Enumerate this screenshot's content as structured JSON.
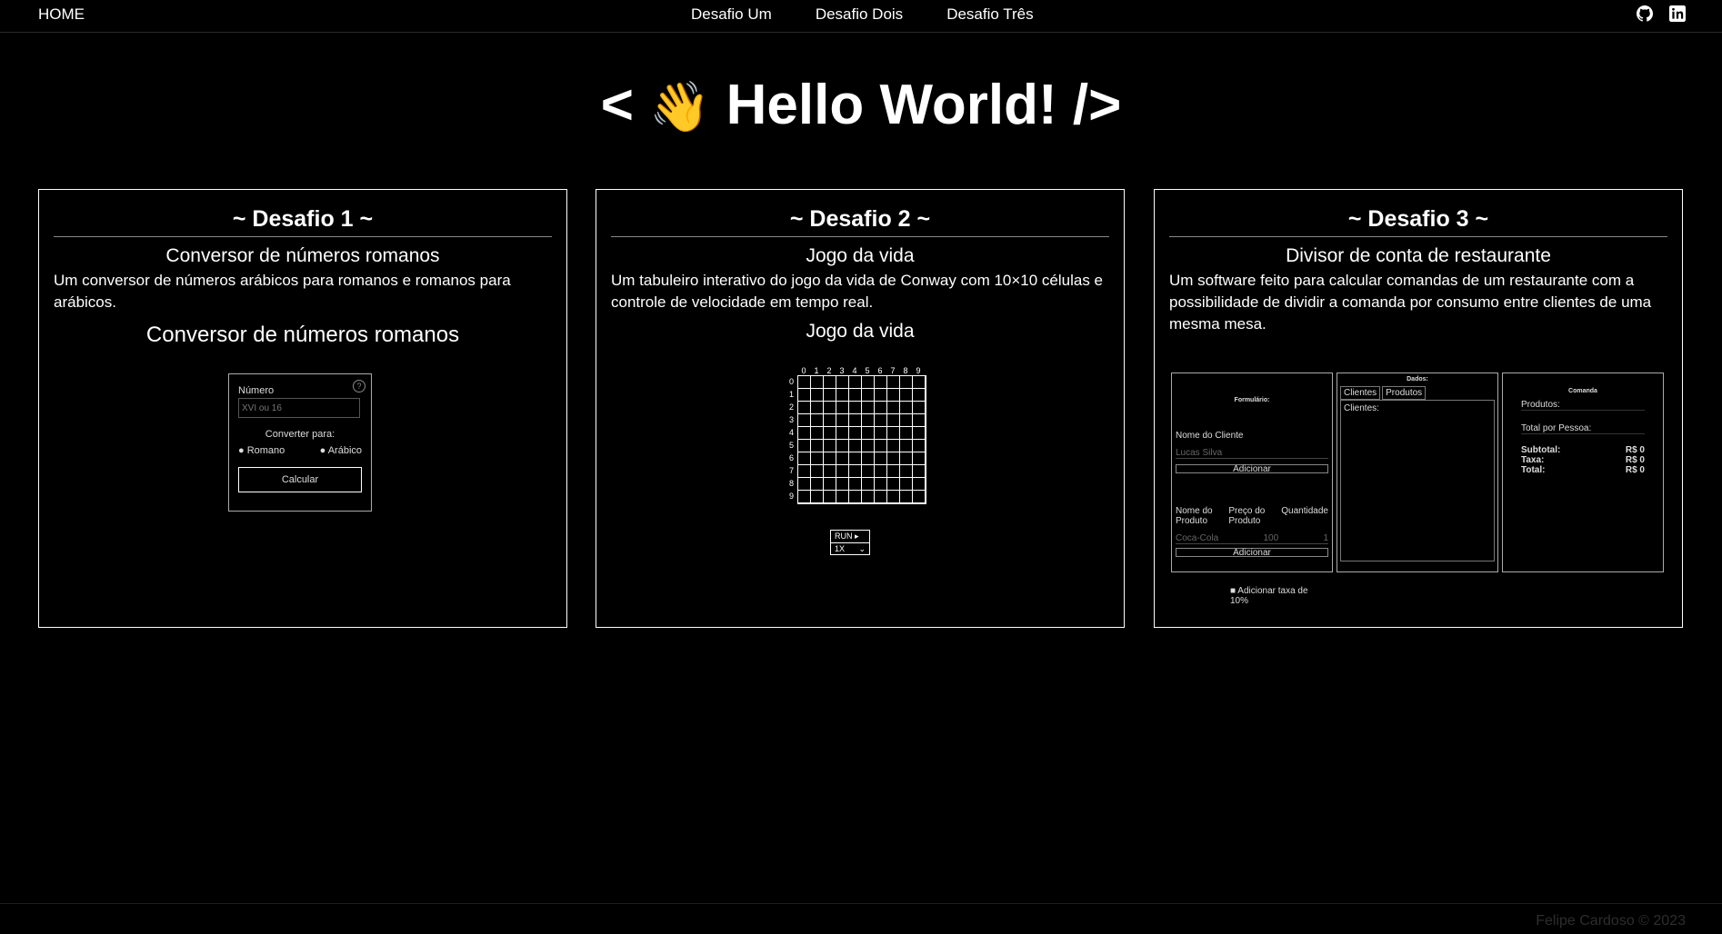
{
  "nav": {
    "home": "HOME",
    "links": [
      "Desafio Um",
      "Desafio Dois",
      "Desafio Três"
    ],
    "icons": [
      "github-icon",
      "linkedin-icon"
    ]
  },
  "hero": {
    "left": "<",
    "emoji": "👋",
    "text": "Hello World!",
    "right": "/>"
  },
  "cards": [
    {
      "title": "~ Desafio 1 ~",
      "subtitle": "Conversor de números romanos",
      "description": "Um conversor de números arábicos para romanos e romanos para arábicos.",
      "preview_title": "Conversor de números romanos",
      "preview": {
        "label_number": "Número",
        "input_placeholder": "XVI ou 16",
        "convert_label": "Converter para:",
        "options": [
          "Romano",
          "Arábico"
        ],
        "button": "Calcular",
        "help": "?"
      }
    },
    {
      "title": "~ Desafio 2 ~",
      "subtitle": "Jogo da vida",
      "description": "Um tabuleiro interativo do jogo da vida de Conway com 10×10 células e controle de velocidade em tempo real.",
      "preview_title": "Jogo da vida",
      "preview": {
        "col_labels": [
          "0",
          "1",
          "2",
          "3",
          "4",
          "5",
          "6",
          "7",
          "8",
          "9"
        ],
        "row_labels": [
          "0",
          "1",
          "2",
          "3",
          "4",
          "5",
          "6",
          "7",
          "8",
          "9"
        ],
        "run_button": "RUN ▸",
        "speed": "1X"
      }
    },
    {
      "title": "~ Desafio 3 ~",
      "subtitle": "Divisor de conta de restaurante",
      "description": "Um software feito para calcular comandas de um restaurante com a possibilidade de dividir a comanda por consumo entre clientes de uma mesma mesa.",
      "preview": {
        "form_title": "Formulário:",
        "client_label": "Nome do Cliente",
        "client_placeholder": "Lucas Silva",
        "add_button": "Adicionar",
        "product_label": "Nome do Produto",
        "price_label": "Preço do Produto",
        "qty_label": "Quantidade",
        "product_placeholder": "Coca-Cola",
        "price_placeholder": "100",
        "qty_placeholder": "1",
        "tax_label": "Adicionar taxa de 10%",
        "data_title": "Dados:",
        "tabs": [
          "Clientes",
          "Produtos"
        ],
        "clients_label": "Clientes:",
        "order_title": "Comanda",
        "products_label": "Produtos:",
        "total_per_person": "Total por Pessoa:",
        "summary": [
          {
            "label": "Subtotal:",
            "value": "R$ 0"
          },
          {
            "label": "Taxa:",
            "value": "R$ 0"
          },
          {
            "label": "Total:",
            "value": "R$ 0"
          }
        ]
      }
    }
  ],
  "footer": {
    "text": "Felipe Cardoso © 2023"
  }
}
